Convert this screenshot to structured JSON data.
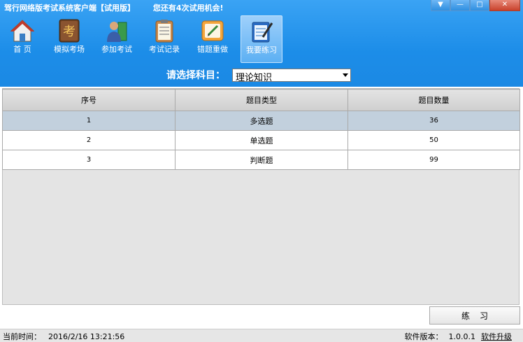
{
  "window": {
    "title": "驾行网络版考试系统客户端【试用版】",
    "notice": "您还有4次试用机会!",
    "controls": {
      "menu": "▼",
      "minimize": "—",
      "maximize": "□",
      "close": "✕"
    }
  },
  "nav": {
    "items": [
      {
        "label": "首 页",
        "icon": "home-icon"
      },
      {
        "label": "模拟考场",
        "icon": "exam-book-icon"
      },
      {
        "label": "参加考试",
        "icon": "person-book-icon"
      },
      {
        "label": "考试记录",
        "icon": "clipboard-icon"
      },
      {
        "label": "错题重做",
        "icon": "paper-pencil-icon"
      },
      {
        "label": "我要练习",
        "icon": "notepad-pen-icon"
      }
    ],
    "active_index": 5
  },
  "subject": {
    "label": "请选择科目：",
    "selected": "理论知识"
  },
  "table": {
    "columns": [
      "序号",
      "题目类型",
      "题目数量"
    ],
    "rows": [
      {
        "no": "1",
        "type": "多选题",
        "count": "36"
      },
      {
        "no": "2",
        "type": "单选题",
        "count": "50"
      },
      {
        "no": "3",
        "type": "判断题",
        "count": "99"
      }
    ],
    "selected_row": 0
  },
  "actions": {
    "practice": "练习"
  },
  "status": {
    "time_label": "当前时间：",
    "time_value": "2016/2/16 13:21:56",
    "version_label": "软件版本：",
    "version_value": "1.0.0.1",
    "upgrade_label": "软件升级"
  },
  "colors": {
    "accent": "#1e8fe8",
    "selected_row": "#c2d0dd"
  }
}
